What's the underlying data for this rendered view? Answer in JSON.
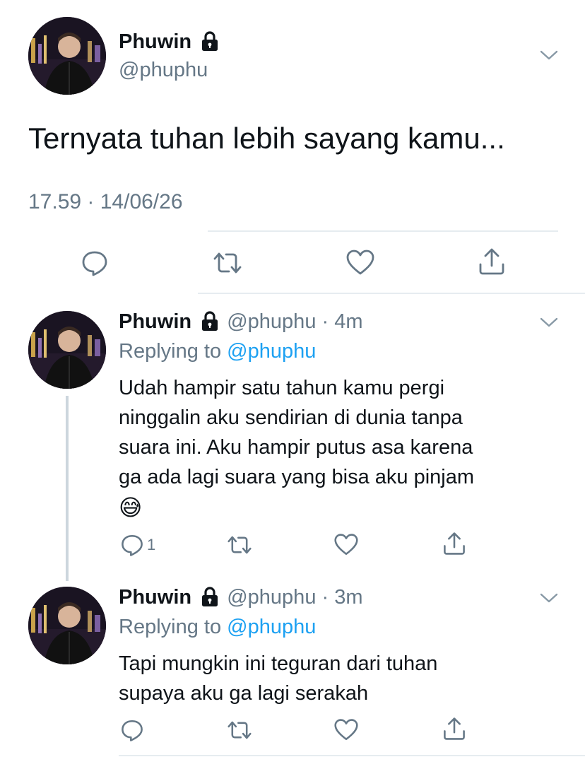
{
  "main_tweet": {
    "author_name": "Phuwin",
    "author_handle": "@phuphu",
    "text": "Ternyata tuhan lebih sayang kamu...",
    "timestamp": "17.59 · 14/06/26"
  },
  "replies": [
    {
      "author_name": "Phuwin",
      "author_handle": "@phuphu",
      "time": "· 4m",
      "replying_prefix": "Replying to ",
      "replying_to": "@phuphu",
      "text_lines": [
        "Udah hampir satu tahun kamu pergi",
        "ninggalin aku sendirian di dunia tanpa",
        "suara ini. Aku hampir putus asa karena",
        "ga ada lagi suara yang bisa aku pinjam"
      ],
      "emoji": "😅",
      "reply_count": "1"
    },
    {
      "author_name": "Phuwin",
      "author_handle": "@phuphu",
      "time": "· 3m",
      "replying_prefix": "Replying to ",
      "replying_to": "@phuphu",
      "text_lines": [
        "Tapi mungkin ini teguran dari tuhan",
        "supaya aku ga lagi serakah"
      ],
      "reply_count": ""
    }
  ],
  "icons": {
    "reply": "reply-icon",
    "retweet": "retweet-icon",
    "like": "heart-icon",
    "share": "share-icon",
    "more": "chevron-down-icon",
    "lock": "lock-icon"
  },
  "colors": {
    "text": "#0f1419",
    "secondary": "#657786",
    "link": "#1da1f2",
    "divider": "#e6ecf0"
  }
}
